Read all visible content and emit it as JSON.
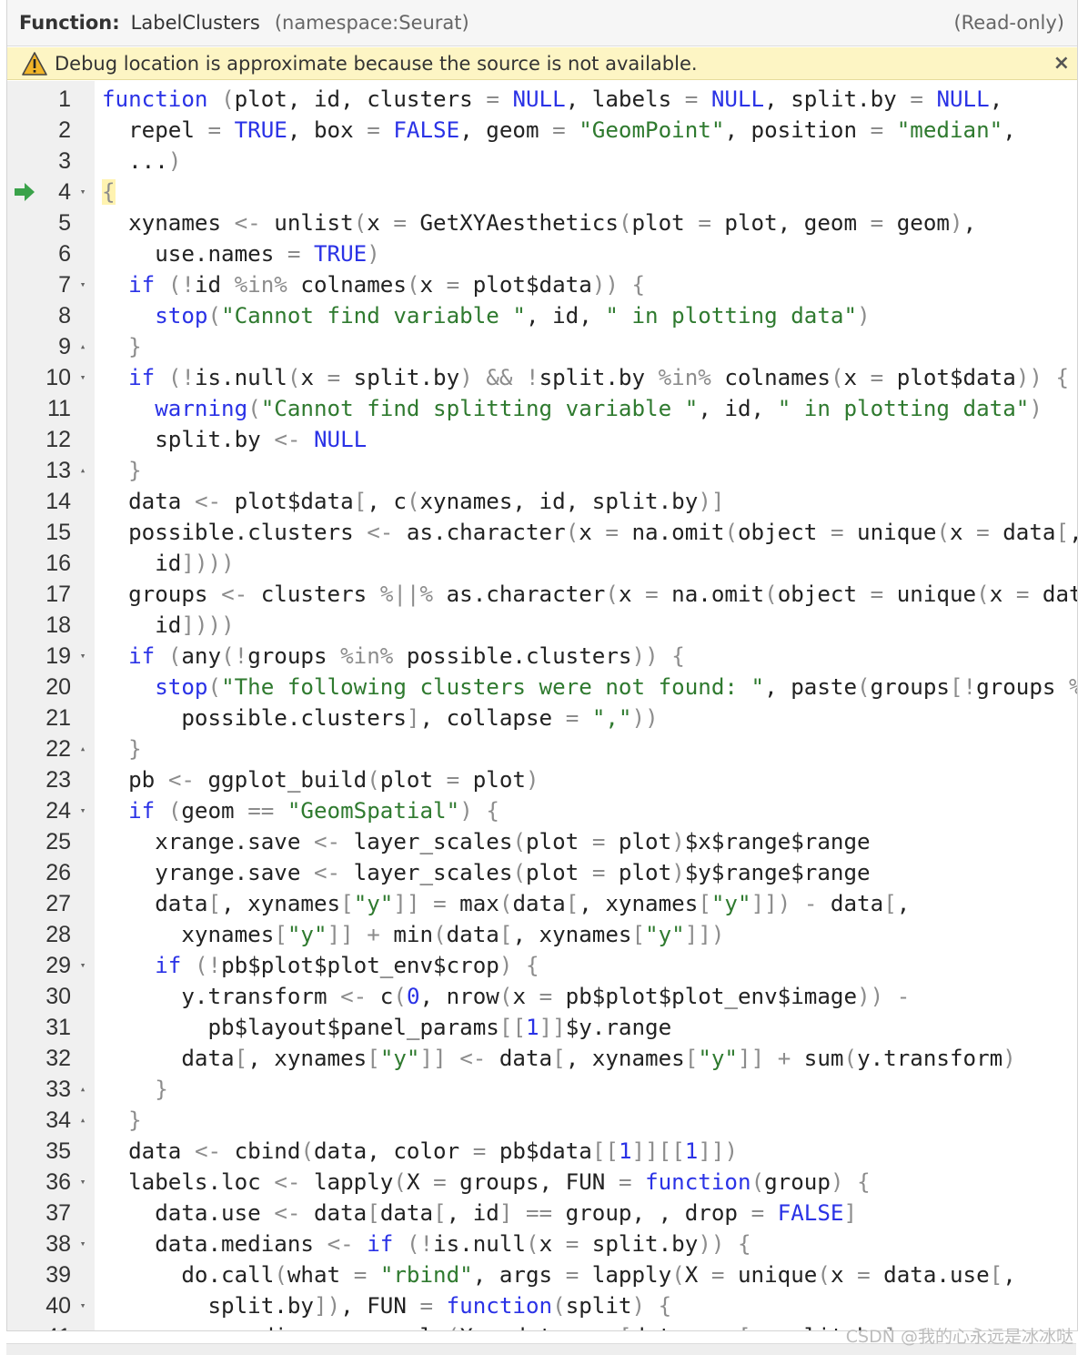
{
  "header": {
    "function_label": "Function:",
    "function_name": "LabelClusters",
    "namespace": "(namespace:Seurat)",
    "status": "(Read-only)"
  },
  "debug_banner": {
    "message": "Debug location is approximate because the source is not available.",
    "close": "×"
  },
  "current_line": 4,
  "fold_markers": {
    "4": "down",
    "7": "down",
    "9": "up",
    "10": "down",
    "13": "up",
    "19": "down",
    "22": "up",
    "24": "down",
    "29": "down",
    "33": "up",
    "34": "up",
    "36": "down",
    "38": "down",
    "40": "down"
  },
  "code_lines": [
    "function (plot, id, clusters = NULL, labels = NULL, split.by = NULL,",
    "  repel = TRUE, box = FALSE, geom = \"GeomPoint\", position = \"median\",",
    "  ...) ",
    "{",
    "  xynames <- unlist(x = GetXYAesthetics(plot = plot, geom = geom),",
    "    use.names = TRUE)",
    "  if (!id %in% colnames(x = plot$data)) {",
    "    stop(\"Cannot find variable \", id, \" in plotting data\")",
    "  }",
    "  if (!is.null(x = split.by) && !split.by %in% colnames(x = plot$data)) {",
    "    warning(\"Cannot find splitting variable \", id, \" in plotting data\")",
    "    split.by <- NULL",
    "  }",
    "  data <- plot$data[, c(xynames, id, split.by)]",
    "  possible.clusters <- as.character(x = na.omit(object = unique(x = data[,",
    "    id])))",
    "  groups <- clusters %||% as.character(x = na.omit(object = unique(x = data[,",
    "    id])))",
    "  if (any(!groups %in% possible.clusters)) {",
    "    stop(\"The following clusters were not found: \", paste(groups[!groups %in%",
    "      possible.clusters], collapse = \",\"))",
    "  }",
    "  pb <- ggplot_build(plot = plot)",
    "  if (geom == \"GeomSpatial\") {",
    "    xrange.save <- layer_scales(plot = plot)$x$range$range",
    "    yrange.save <- layer_scales(plot = plot)$y$range$range",
    "    data[, xynames[\"y\"]] = max(data[, xynames[\"y\"]]) - data[,",
    "      xynames[\"y\"]] + min(data[, xynames[\"y\"]])",
    "    if (!pb$plot$plot_env$crop) {",
    "      y.transform <- c(0, nrow(x = pb$plot$plot_env$image)) -",
    "        pb$layout$panel_params[[1]]$y.range",
    "      data[, xynames[\"y\"]] <- data[, xynames[\"y\"]] + sum(y.transform)",
    "    }",
    "  }",
    "  data <- cbind(data, color = pb$data[[1]][[1]])",
    "  labels.loc <- lapply(X = groups, FUN = function(group) {",
    "    data.use <- data[data[, id] == group, , drop = FALSE]",
    "    data.medians <- if (!is.null(x = split.by)) {",
    "      do.call(what = \"rbind\", args = lapply(X = unique(x = data.use[,",
    "        split.by]), FUN = function(split) {",
    "          medians <- apply(X = data.use[data.use[, split.by] =="
  ],
  "watermark": "CSDN @我的心永远是冰冰哒",
  "colors": {
    "keyword": "#2a32e6",
    "string": "#2f7a2f",
    "operator": "#8c8c8c",
    "debug_banner_bg": "#fdf5c4",
    "current_line_arrow": "#3aa24a"
  },
  "icons": {
    "warning": "warning-triangle-icon",
    "current_line": "green-arrow-icon",
    "fold_open": "fold-down-icon",
    "fold_close": "fold-up-icon"
  }
}
